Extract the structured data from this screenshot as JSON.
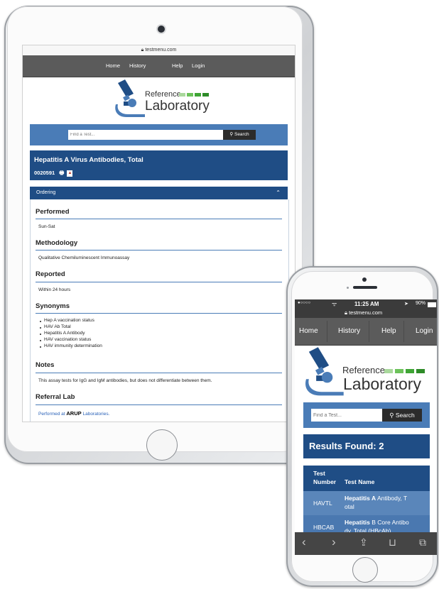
{
  "tablet": {
    "url": "testmenu.com",
    "nav": [
      "Home",
      "History",
      "Help",
      "Login"
    ],
    "logo": {
      "top": "Reference",
      "bottom": "Laboratory"
    },
    "search": {
      "placeholder": "Find a Test...",
      "button": "Search"
    },
    "test_title": "Hepatitis A Virus Antibodies, Total",
    "test_code": "0020591",
    "ordering_label": "Ordering",
    "sections": {
      "performed": {
        "heading": "Performed",
        "text": "Sun-Sat"
      },
      "methodology": {
        "heading": "Methodology",
        "text": "Qualitative Chemiluminescent Immunoassay"
      },
      "reported": {
        "heading": "Reported",
        "text": "Within 24 hours"
      },
      "synonyms": {
        "heading": "Synonyms",
        "items": [
          "Hep A vaccination status",
          "HAV Ab Total",
          "Hepatitis A Antibody",
          "HAV vaccination status",
          "HAV immunity determination"
        ]
      },
      "notes": {
        "heading": "Notes",
        "text": "This assay tests for IgG and IgM antibodies, but does not differentiate between them."
      },
      "referral": {
        "heading": "Referral Lab",
        "text_before": "Performed at",
        "arup": "ARUP",
        "text_after": "Laboratories."
      }
    }
  },
  "phone": {
    "status": {
      "carrier": "●○○○○",
      "time": "11:25 AM",
      "battery": "90%",
      "url": "testmenu.com"
    },
    "nav": [
      "Home",
      "History",
      "Help",
      "Login"
    ],
    "logo": {
      "top": "Reference",
      "bottom": "Laboratory"
    },
    "search": {
      "placeholder": "Find a Test...",
      "button": "Search"
    },
    "results_label": "Results Found: 2",
    "table": {
      "headers": {
        "number_line1": "Test",
        "number_line2": "Number",
        "name": "Test Name"
      },
      "rows": [
        {
          "number": "HAVTL",
          "name_bold": "Hepatitis A",
          "name_rest": " Antibody, T",
          "name_line2": "otal"
        },
        {
          "number": "HBCAB",
          "name_bold": "Hepatitis",
          "name_rest": " B Core Antibo",
          "name_line2": "dy, Total (HBcAb)"
        }
      ]
    }
  },
  "colors": {
    "nav_gray": "#5b5b5b",
    "accent_blue": "#4a7cb7",
    "dark_blue": "#1f4d85",
    "logo_green": "#3fa535"
  }
}
